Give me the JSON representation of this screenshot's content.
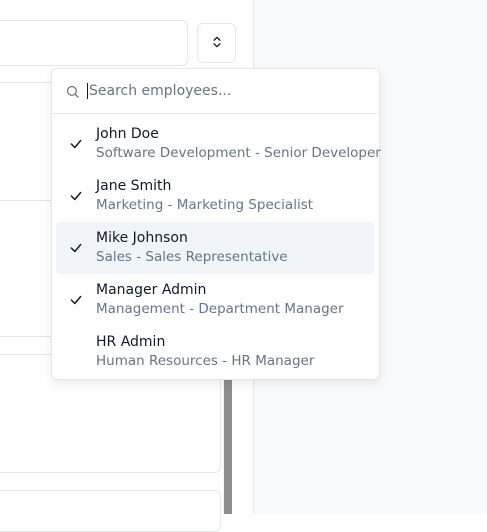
{
  "search": {
    "placeholder": "Search employees..."
  },
  "employees": [
    {
      "name": "John Doe",
      "detail": "Software Development - Senior Developer",
      "selected": true
    },
    {
      "name": "Jane Smith",
      "detail": "Marketing - Marketing Specialist",
      "selected": true
    },
    {
      "name": "Mike Johnson",
      "detail": "Sales - Sales Representative",
      "selected": true
    },
    {
      "name": "Manager Admin",
      "detail": "Management - Department Manager",
      "selected": true
    },
    {
      "name": "HR Admin",
      "detail": "Human Resources - HR Manager",
      "selected": false
    }
  ],
  "icons": {
    "toggle": "chevrons-up-down-icon",
    "search": "search-icon",
    "check": "check-icon"
  }
}
